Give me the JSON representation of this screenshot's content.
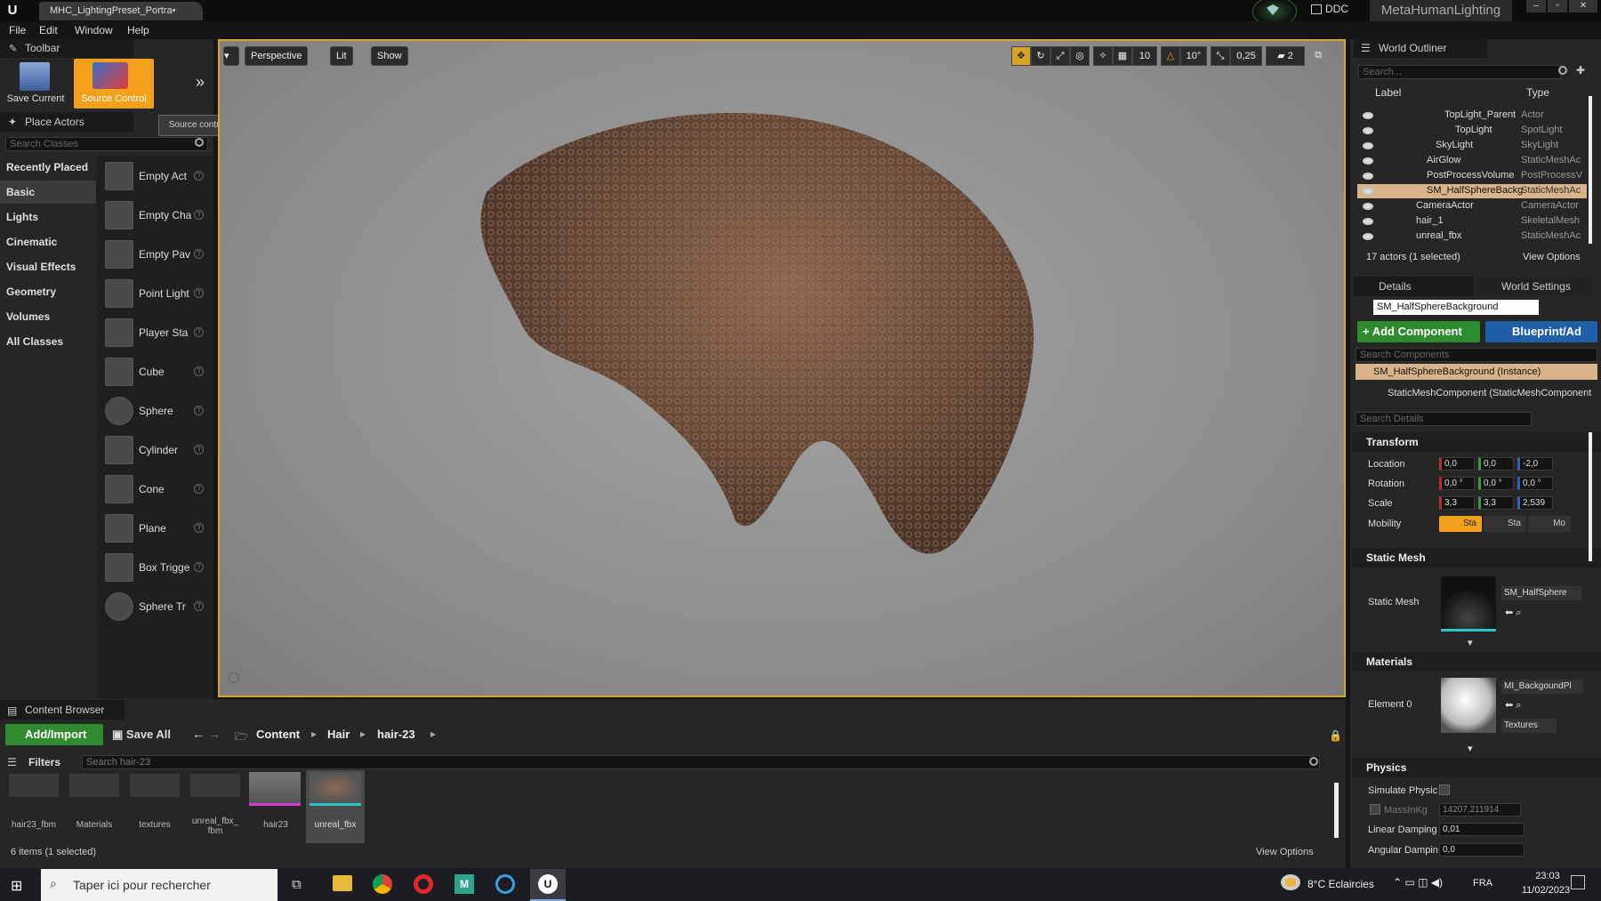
{
  "window": {
    "doc_tab": "MHC_LightingPreset_Portra•",
    "ddc": "DDC",
    "project": "MetaHumanLighting"
  },
  "menu": [
    "File",
    "Edit",
    "Window",
    "Help"
  ],
  "toolbar": {
    "title": "Toolbar",
    "save_label": "Save Current",
    "source_label": "Source Control",
    "tooltip": "Source control is disabled"
  },
  "place_actors": {
    "title": "Place Actors",
    "search_placeholder": "Search Classes",
    "categories": [
      "Recently Placed",
      "Basic",
      "Lights",
      "Cinematic",
      "Visual Effects",
      "Geometry",
      "Volumes",
      "All Classes"
    ],
    "items": [
      "Empty Act",
      "Empty Cha",
      "Empty Pav",
      "Point Light",
      "Player Sta",
      "Cube",
      "Sphere",
      "Cylinder",
      "Cone",
      "Plane",
      "Box Trigge",
      "Sphere Tr"
    ]
  },
  "viewport": {
    "perspective": "Perspective",
    "lit": "Lit",
    "show": "Show",
    "grid": "10",
    "angle": "10°",
    "scale": "0,25",
    "cam": "2"
  },
  "outliner": {
    "title": "World Outliner",
    "search_placeholder": "Search...",
    "col_label": "Label",
    "col_type": "Type",
    "rows": [
      {
        "label": "TopLight_Parent",
        "type": "Actor"
      },
      {
        "label": "TopLight",
        "type": "SpotLight"
      },
      {
        "label": "SkyLight",
        "type": "SkyLight"
      },
      {
        "label": "AirGlow",
        "type": "StaticMeshAc"
      },
      {
        "label": "PostProcessVolume",
        "type": "PostProcessV"
      },
      {
        "label": "SM_HalfSphereBackg",
        "type": "StaticMeshAc"
      },
      {
        "label": "CameraActor",
        "type": "CameraActor"
      },
      {
        "label": "hair_1",
        "type": "SkeletalMesh"
      },
      {
        "label": "unreal_fbx",
        "type": "StaticMeshAc"
      }
    ],
    "count": "17 actors (1 selected)",
    "view_options": "View Options"
  },
  "details": {
    "tab": "Details",
    "world_tab": "World Settings",
    "name": "SM_HalfSphereBackground",
    "add_component": "+ Add Component",
    "blueprint": "Blueprint/Ad",
    "search_components": "Search Components",
    "instance": "SM_HalfSphereBackground (Instance)",
    "component": "StaticMeshComponent (StaticMeshComponent",
    "search_details": "Search Details",
    "transform": "Transform",
    "location_label": "Location",
    "location": [
      "0,0",
      "0,0",
      "-2,0"
    ],
    "rotation_label": "Rotation",
    "rotation": [
      "0,0 °",
      "0,0 °",
      "0,0 °"
    ],
    "scale_label": "Scale",
    "scale": [
      "3,3",
      "3,3",
      "2,539"
    ],
    "mobility_label": "Mobility",
    "mobility": [
      "Sta",
      "Sta",
      "Mo"
    ],
    "static_mesh_section": "Static Mesh",
    "static_mesh_label": "Static Mesh",
    "static_mesh_value": "SM_HalfSphere",
    "materials_section": "Materials",
    "element0": "Element 0",
    "material_value": "MI_BackgoundPl",
    "textures": "Textures",
    "physics_section": "Physics",
    "simulate": "Simulate Physic",
    "mass_label": "MassInKg",
    "mass": "14207,211914",
    "linear_label": "Linear Damping",
    "linear": "0,01",
    "angular_label": "Angular Dampin",
    "angular": "0,0"
  },
  "content_browser": {
    "title": "Content Browser",
    "add_import": "Add/Import",
    "save_all": "Save All",
    "path": [
      "Content",
      "Hair",
      "hair-23"
    ],
    "filters": "Filters",
    "search_placeholder": "Search hair-23",
    "assets": [
      "hair23_fbm",
      "Materials",
      "textures",
      "unreal_fbx_\nfbm",
      "hair23",
      "unreal_fbx"
    ],
    "count": "6 items (1 selected)",
    "view_options": "View Options"
  },
  "taskbar": {
    "search": "Taper ici pour rechercher",
    "weather": "8°C  Eclaircies",
    "lang": "FRA",
    "time": "23:03",
    "date": "11/02/2023"
  },
  "colors": {
    "accent": "#d7a429",
    "source_control": "#f3a01a",
    "add_green": "#2f8b2f",
    "blueprint_blue": "#1f5fa8",
    "selected_row": "#d9b48a"
  }
}
